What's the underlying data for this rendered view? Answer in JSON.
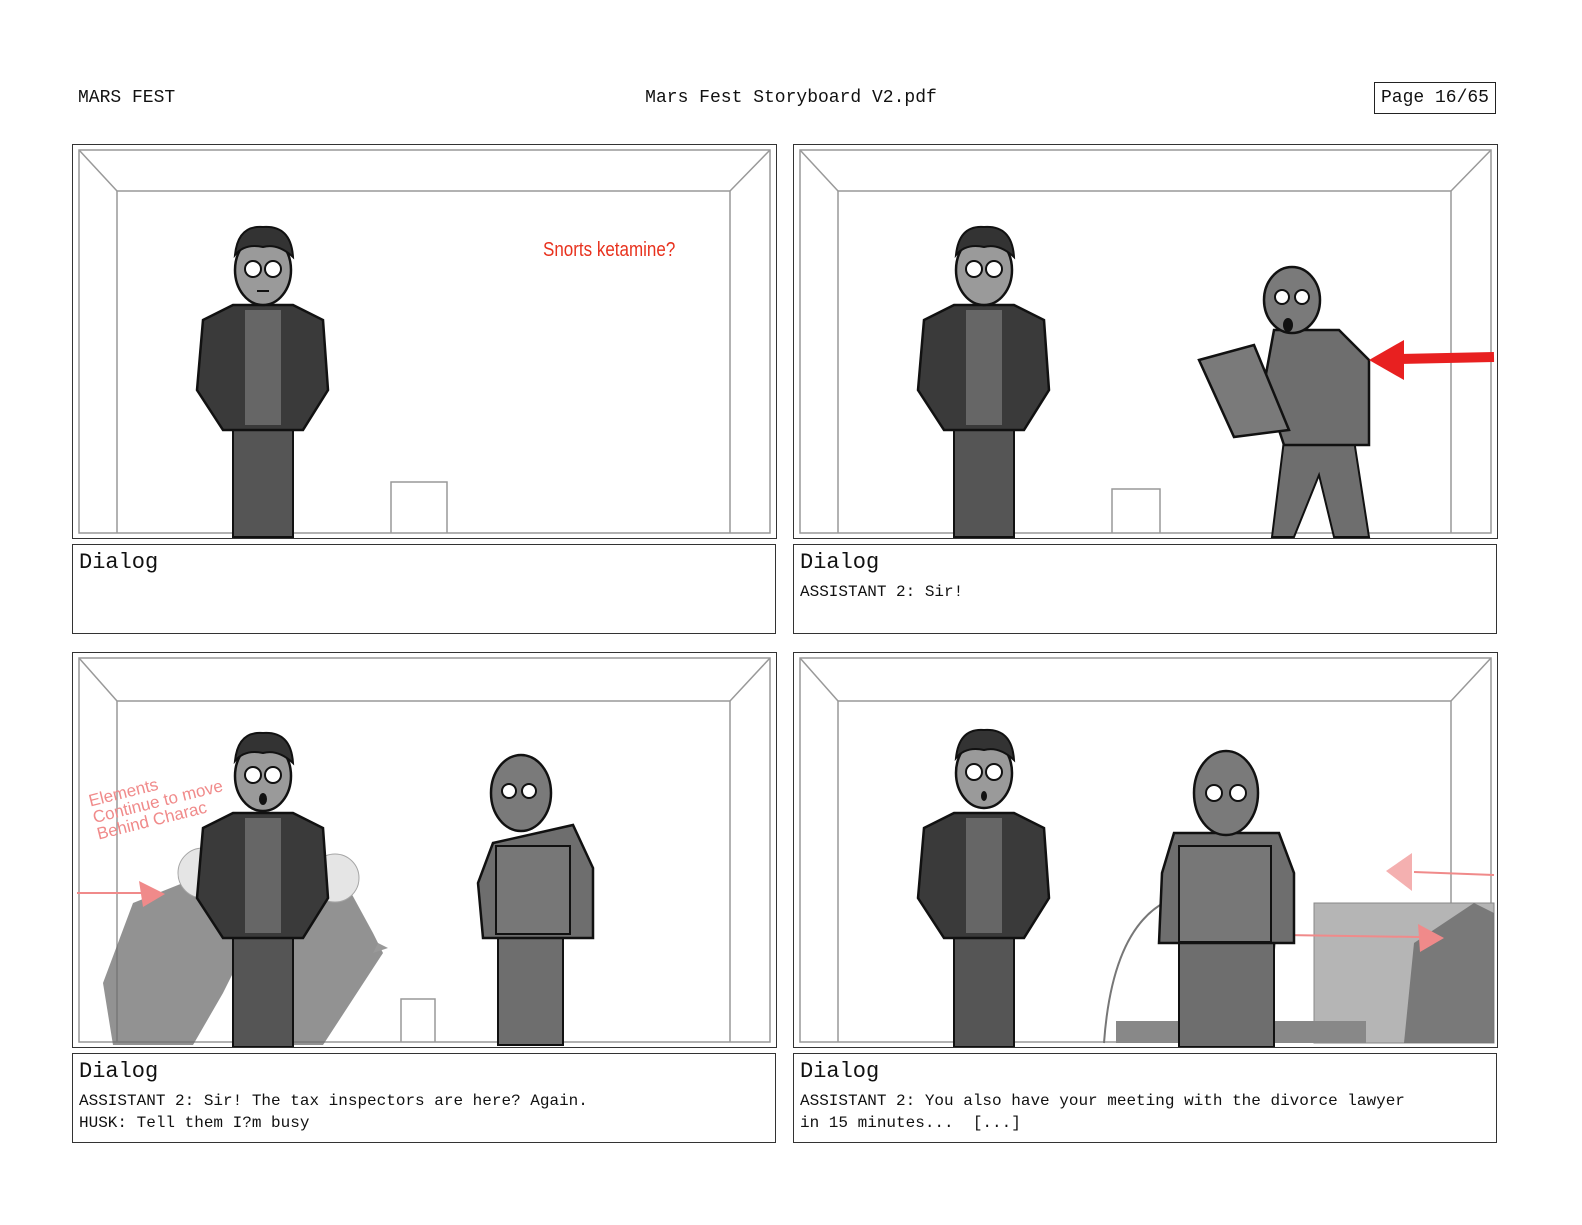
{
  "header": {
    "left": "MARS FEST",
    "center": "Mars Fest Storyboard V2.pdf",
    "page": "Page 16/65"
  },
  "panels": [
    {
      "annotation": "Snorts ketamine?",
      "dialog_title": "Dialog",
      "lines": []
    },
    {
      "dialog_title": "Dialog",
      "lines": [
        "ASSISTANT 2: Sir!"
      ]
    },
    {
      "annotation": "Elements\nContinue to move\nBehind Charac",
      "dialog_title": "Dialog",
      "lines": [
        "ASSISTANT 2: Sir! The tax inspectors are here? Again.",
        "HUSK: Tell them I?m busy"
      ]
    },
    {
      "dialog_title": "Dialog",
      "lines": [
        "ASSISTANT 2: You also have your meeting with the divorce lawyer",
        "in 15 minutes...  [...]"
      ]
    }
  ],
  "colors": {
    "annotation_red": "#e8321e",
    "annotation_pink": "#f08a8a",
    "figure_dark": "#4a4a4a",
    "figure_mid": "#6e6e6e"
  }
}
